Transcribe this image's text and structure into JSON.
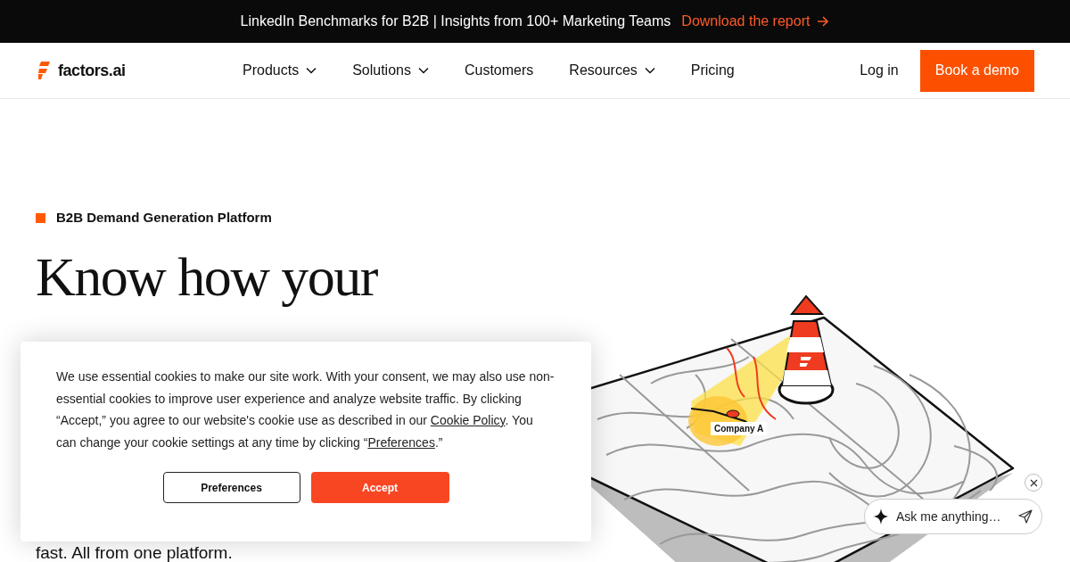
{
  "announcement": {
    "text": "LinkedIn Benchmarks for B2B | Insights from 100+ Marketing Teams",
    "link": "Download the report"
  },
  "nav": {
    "logo": "factors.ai",
    "items": [
      {
        "label": "Products",
        "has_menu": true
      },
      {
        "label": "Solutions",
        "has_menu": true
      },
      {
        "label": "Customers",
        "has_menu": false
      },
      {
        "label": "Resources",
        "has_menu": true
      },
      {
        "label": "Pricing",
        "has_menu": false
      }
    ],
    "login": "Log in",
    "cta": "Book a demo"
  },
  "hero": {
    "eyebrow": "B2B Demand Generation Platform",
    "heading_lines": [
      "Know how your"
    ],
    "subtitle": "fast. All from one platform."
  },
  "illustration": {
    "label": "Company A"
  },
  "cookie_banner": {
    "parts": [
      {
        "kind": "text",
        "text": "We use essential cookies to make our site work. With your consent, we may also use non-essential cookies to improve user experience and analyze website traffic. By clicking “Accept,” you agree to our website's cookie use as described in our "
      },
      {
        "kind": "link",
        "text": "Cookie Policy"
      },
      {
        "kind": "text",
        "text": ". You can change your cookie settings at any time by clicking “"
      },
      {
        "kind": "link",
        "text": "Preferences"
      },
      {
        "kind": "text",
        "text": ".”"
      }
    ],
    "buttons": [
      {
        "label": "Preferences",
        "kind": "secondary"
      },
      {
        "label": "Accept",
        "kind": "primary"
      }
    ]
  },
  "chat": {
    "placeholder": "Ask me anything…"
  }
}
